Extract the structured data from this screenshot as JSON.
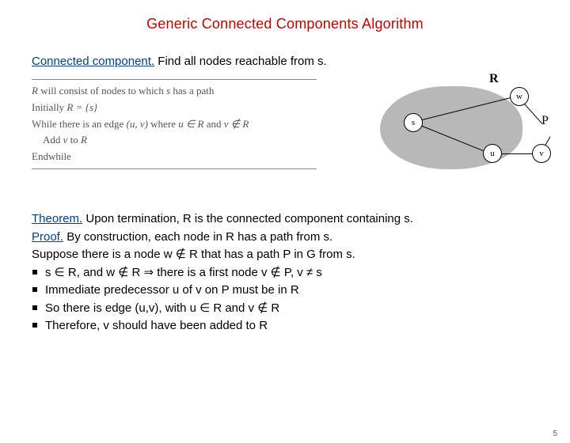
{
  "title": "Generic Connected Components Algorithm",
  "definition": {
    "term": "Connected component.",
    "rest": "  Find all nodes reachable from s."
  },
  "pseudo": {
    "l1a": "R",
    "l1b": " will consist of nodes to which ",
    "l1c": "s",
    "l1d": " has a path",
    "l2a": "Initially ",
    "l2b": "R = {s}",
    "l3a": "While there is an edge ",
    "l3b": "(u, v)",
    "l3c": " where ",
    "l3d": "u ∈ R",
    "l3e": " and ",
    "l3f": "v ∉ R",
    "l4a": "Add ",
    "l4b": "v",
    "l4c": " to ",
    "l4d": "R",
    "l5": "Endwhile"
  },
  "diagram": {
    "R": "R",
    "P": "P",
    "w": "w",
    "s": "s",
    "u": "u",
    "v": "v"
  },
  "theorem": {
    "term": "Theorem.",
    "line1": "  Upon termination, R is the connected component containing s.",
    "proof_term": "Proof.",
    "proof_rest": " By construction, each node in R has a path from s.",
    "suppose": "Suppose there is a node w ∉ R that has a path P in G from s.",
    "bullets": [
      "s ∈ R, and w ∉ R ⇒ there is a first node v ∉ P, v ≠ s",
      "Immediate predecessor u of v on P must be in R",
      "So there is edge (u,v), with u ∈ R and v ∉ R",
      "Therefore, v should have been added to R"
    ]
  },
  "pagenum": "5"
}
